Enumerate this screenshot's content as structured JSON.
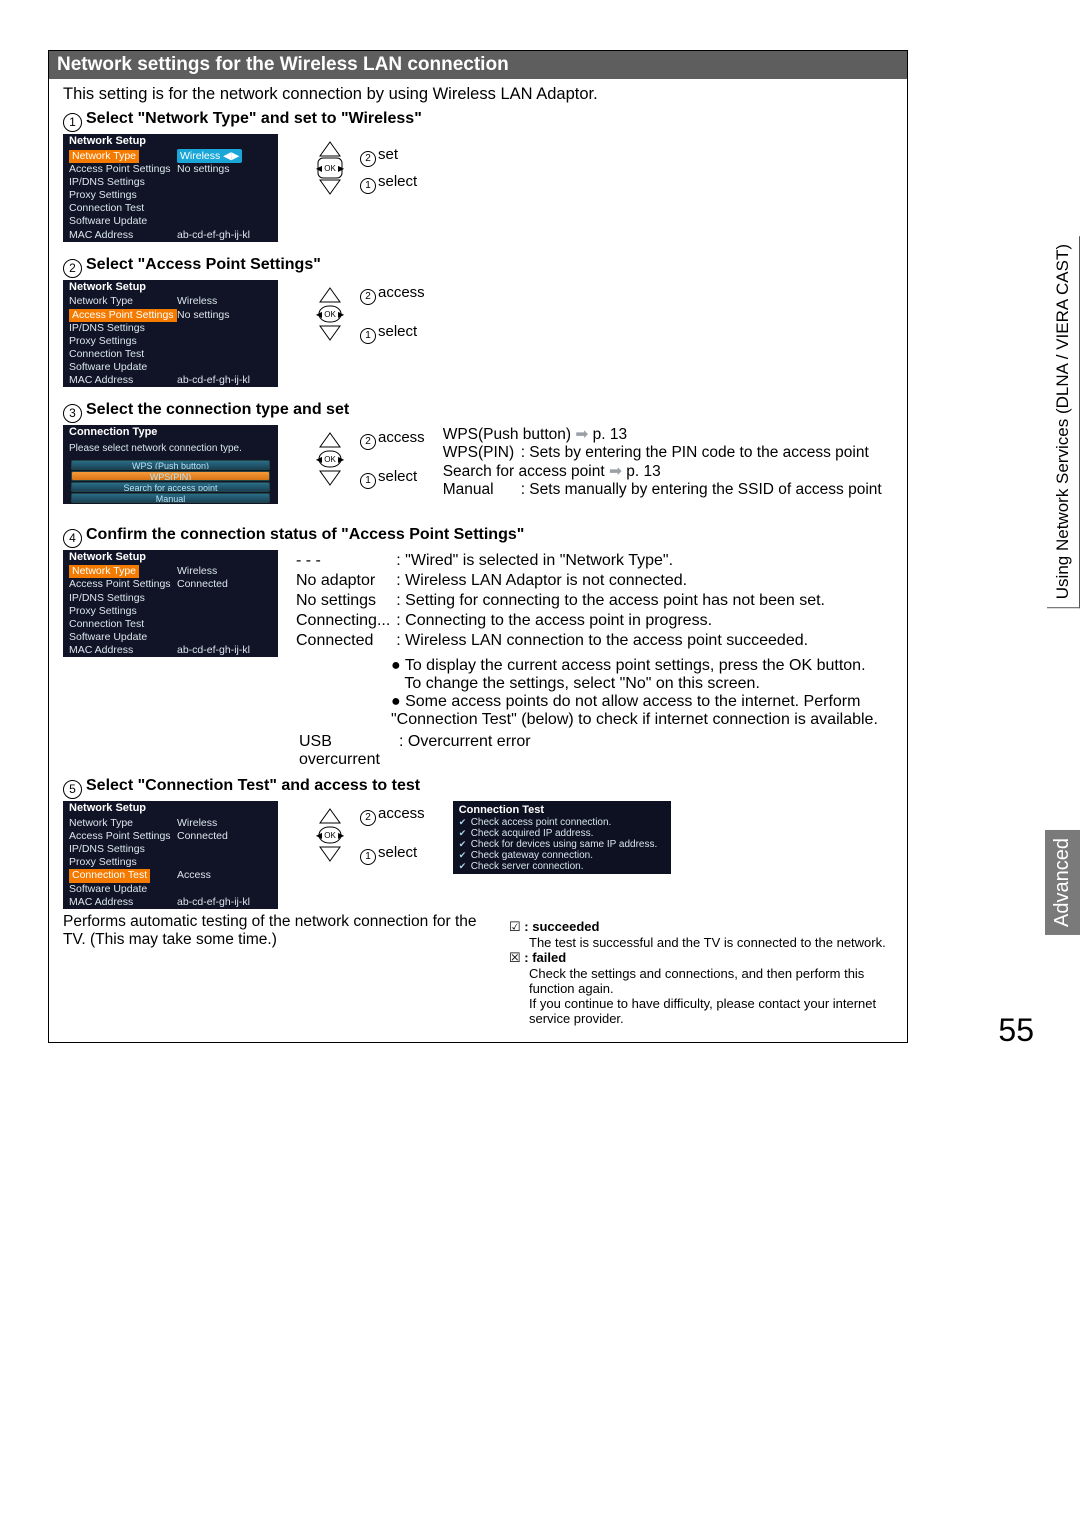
{
  "title": "Network settings for the Wireless LAN connection",
  "intro": "This setting is for the network connection by using Wireless LAN Adaptor.",
  "side": {
    "adv": "Advanced",
    "svc": "Using Network Services (DLNA / VIERA CAST)"
  },
  "pageNo": "55",
  "dpad": {
    "set": "set",
    "select": "select",
    "access": "access"
  },
  "panel1": {
    "title": "Network Setup",
    "rows": [
      {
        "l": "Network Type",
        "v": "Wireless",
        "hlL": true,
        "selV": true
      },
      {
        "l": "Access Point Settings",
        "v": "No settings"
      },
      {
        "l": "IP/DNS Settings",
        "v": ""
      },
      {
        "l": "Proxy Settings",
        "v": ""
      },
      {
        "l": "Connection Test",
        "v": ""
      },
      {
        "l": "Software Update",
        "v": ""
      },
      {
        "l": "MAC Address",
        "v": "ab-cd-ef-gh-ij-kl"
      }
    ]
  },
  "step1": "Select \"Network Type\" and set to \"Wireless\"",
  "step2": "Select \"Access Point Settings\"",
  "panel2": {
    "title": "Network Setup",
    "rows": [
      {
        "l": "Network Type",
        "v": "Wireless"
      },
      {
        "l": "Access Point Settings",
        "v": "No settings",
        "hlL": true
      },
      {
        "l": "IP/DNS Settings",
        "v": ""
      },
      {
        "l": "Proxy Settings",
        "v": ""
      },
      {
        "l": "Connection Test",
        "v": ""
      },
      {
        "l": "Software Update",
        "v": ""
      },
      {
        "l": "MAC Address",
        "v": "ab-cd-ef-gh-ij-kl"
      }
    ]
  },
  "step3": "Select the connection type and set",
  "panel3": {
    "title": "Connection Type",
    "prompt": "Please select network connection type.",
    "items": [
      "WPS (Push button)",
      "WPS(PIN)",
      "Search for access point",
      "Manual"
    ]
  },
  "step3side": {
    "r1a": "WPS(Push button)",
    "r1b": "p. 13",
    "r2a": "WPS(PIN)",
    "r2b": ": Sets by entering the PIN code to the access point",
    "r3a": "Search for access point",
    "r3b": "p. 13",
    "r4a": "Manual",
    "r4b": ": Sets manually by entering the SSID of access point"
  },
  "step4": "Confirm the connection status of \"Access Point Settings\"",
  "panel4": {
    "title": "Network Setup",
    "rows": [
      {
        "l": "Network Type",
        "v": "Wireless",
        "hlL": true
      },
      {
        "l": "Access Point Settings",
        "v": "Connected"
      },
      {
        "l": "IP/DNS Settings",
        "v": ""
      },
      {
        "l": "Proxy Settings",
        "v": ""
      },
      {
        "l": "Connection Test",
        "v": ""
      },
      {
        "l": "Software Update",
        "v": ""
      },
      {
        "l": "MAC Address",
        "v": "ab-cd-ef-gh-ij-kl"
      }
    ]
  },
  "status": {
    "r1a": "- - -",
    "r1b": ": \"Wired\" is selected in \"Network Type\".",
    "r2a": "No adaptor",
    "r2b": ": Wireless LAN Adaptor is not connected.",
    "r3a": "No settings",
    "r3b": ": Setting for connecting to the access point has not been set.",
    "r4a": "Connecting...",
    "r4b": ": Connecting to the access point in progress.",
    "r5a": "Connected",
    "r5b": ": Wireless LAN connection to the access point succeeded.",
    "b1": "To display the current access point settings, press the OK button.",
    "b2": "To change the settings, select \"No\" on this screen.",
    "b3": "Some access points do not allow access to the internet. Perform \"Connection Test\" (below) to check if internet connection is available.",
    "r6a": "USB overcurrent",
    "r6b": ": Overcurrent error"
  },
  "step5": "Select \"Connection Test\" and access to test",
  "panel5": {
    "title": "Network Setup",
    "rows": [
      {
        "l": "Network Type",
        "v": "Wireless"
      },
      {
        "l": "Access Point Settings",
        "v": "Connected"
      },
      {
        "l": "IP/DNS Settings",
        "v": ""
      },
      {
        "l": "Proxy Settings",
        "v": ""
      },
      {
        "l": "Connection Test",
        "v": "Access",
        "hlL": true
      },
      {
        "l": "Software Update",
        "v": ""
      },
      {
        "l": "MAC Address",
        "v": "ab-cd-ef-gh-ij-kl"
      }
    ]
  },
  "ct": {
    "title": "Connection Test",
    "items": [
      "Check access point connection.",
      "Check acquired IP address.",
      "Check for devices using same IP address.",
      "Check gateway connection.",
      "Check server connection."
    ]
  },
  "perf": "Performs automatic testing of the network connection for the TV. (This may take some time.)",
  "legend": {
    "sLab": ": succeeded",
    "sTxt": "The test is successful and the TV is connected to the network.",
    "fLab": ": failed",
    "fTxt1": "Check the settings and connections, and then perform this function again.",
    "fTxt2": "If you continue to have difficulty, please contact your internet service provider."
  }
}
